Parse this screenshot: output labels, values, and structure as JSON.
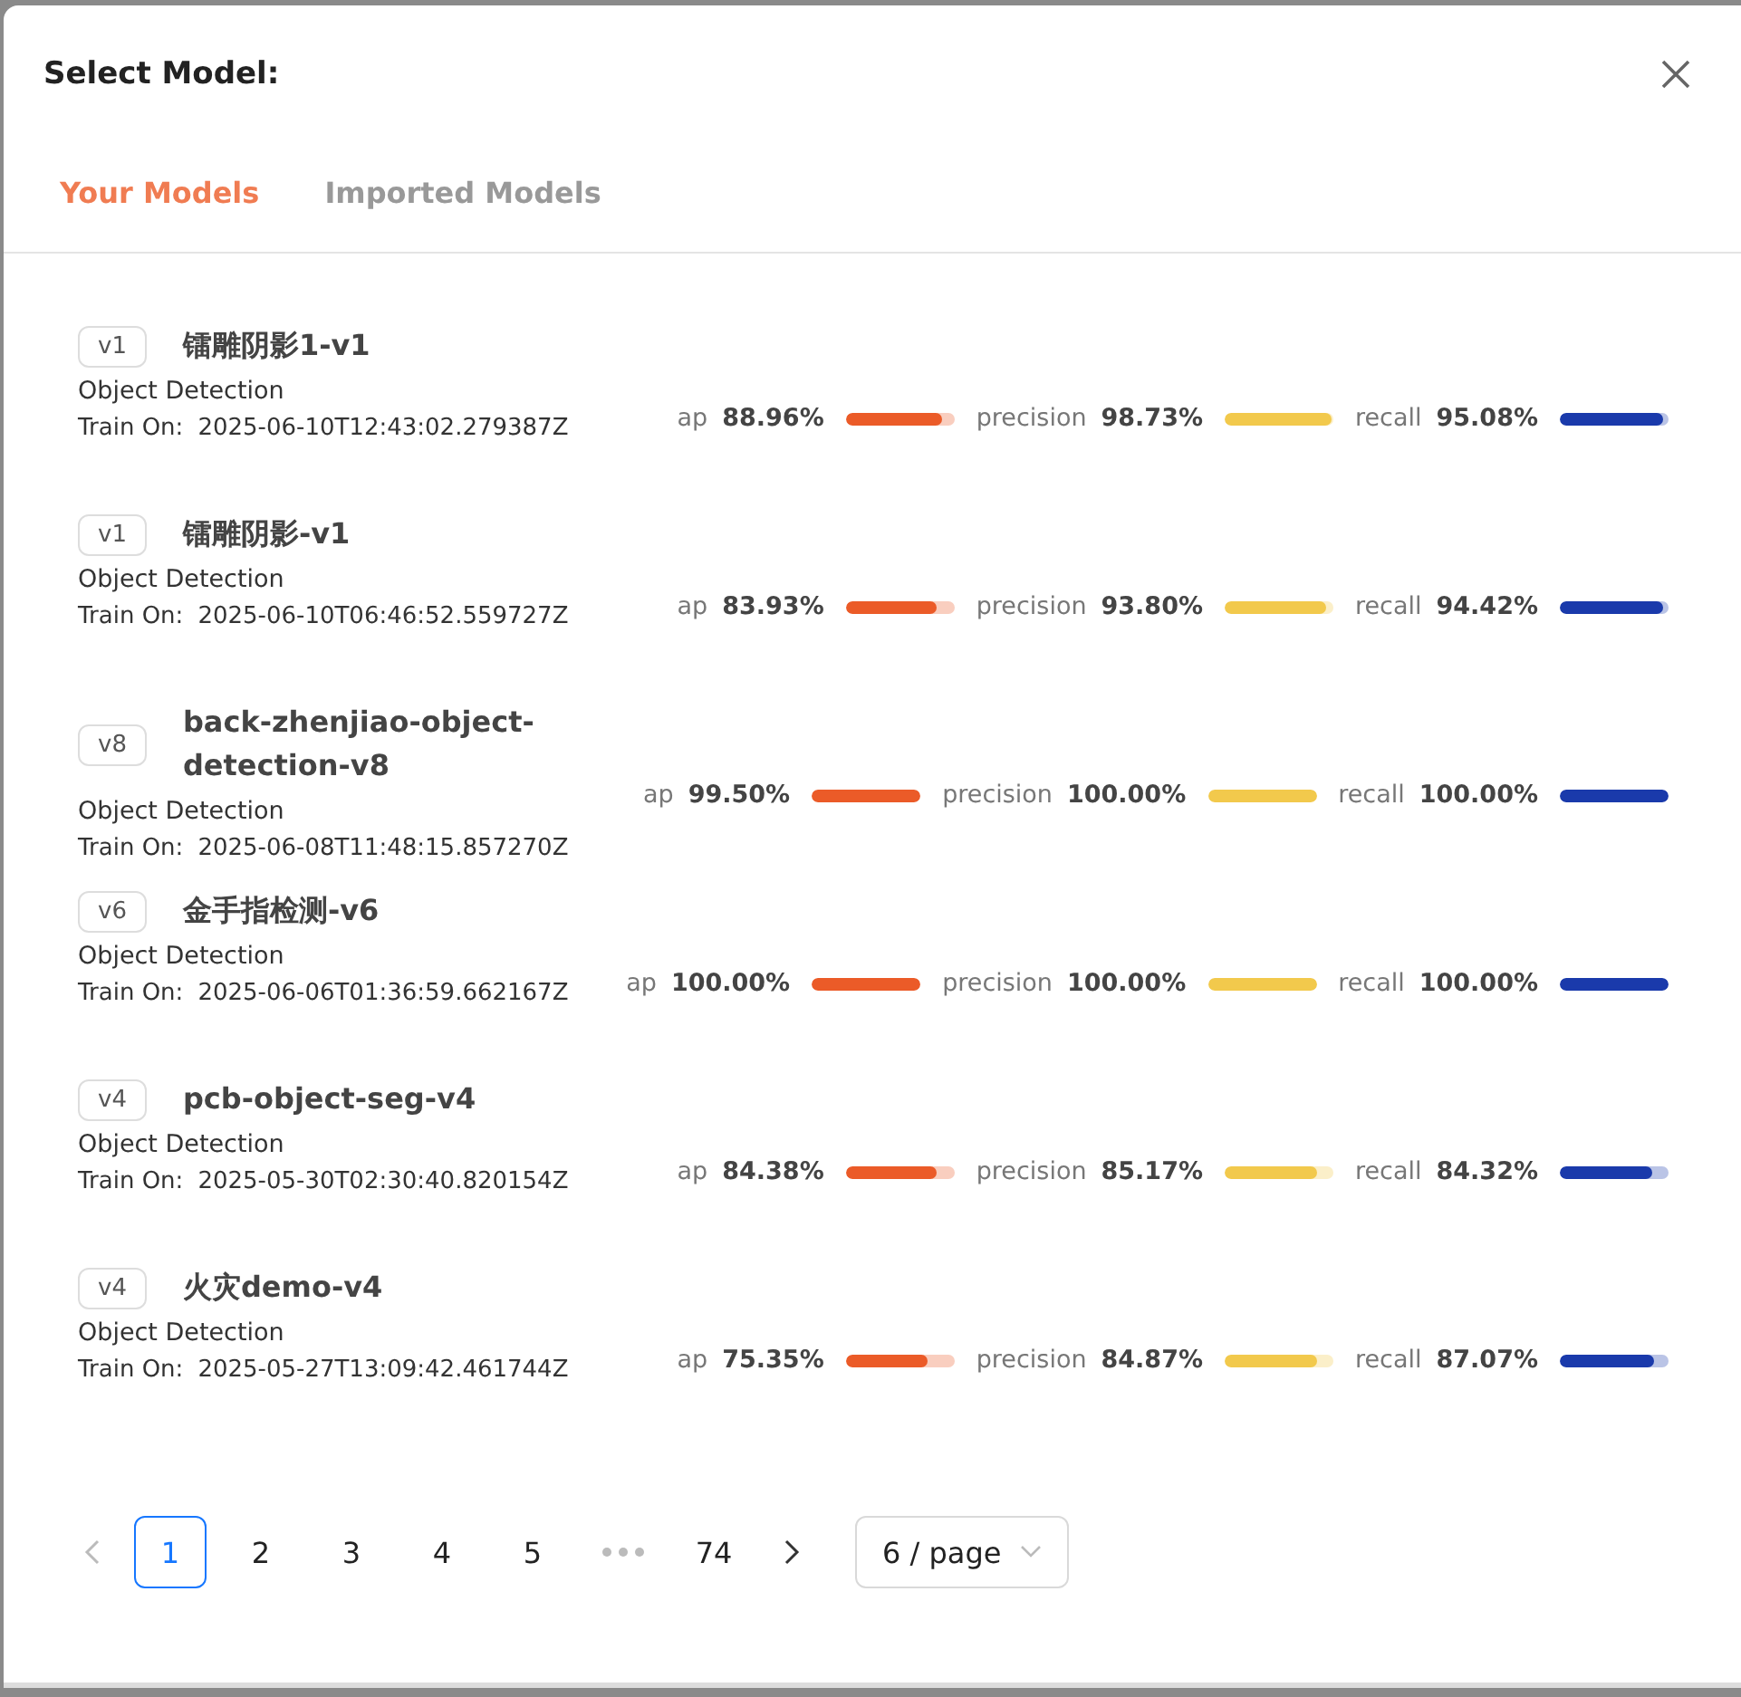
{
  "dialog": {
    "title": "Select Model:"
  },
  "tabs": [
    {
      "label": "Your Models",
      "selected": true
    },
    {
      "label": "Imported Models",
      "selected": false
    }
  ],
  "models": [
    {
      "version": "v1",
      "name": "镭雕阴影1-v1",
      "task": "Object Detection",
      "train_label": "Train On:",
      "train_on": "2025-06-10T12:43:02.279387Z",
      "metrics": [
        {
          "label": "ap",
          "value": "88.96%",
          "level": 0.8896,
          "color": "#eb5b28"
        },
        {
          "label": "precision",
          "value": "98.73%",
          "level": 0.9873,
          "color": "#f2c94c"
        },
        {
          "label": "recall",
          "value": "95.08%",
          "level": 0.9508,
          "color": "#1a3aab"
        }
      ]
    },
    {
      "version": "v1",
      "name": "镭雕阴影-v1",
      "task": "Object Detection",
      "train_label": "Train On:",
      "train_on": "2025-06-10T06:46:52.559727Z",
      "metrics": [
        {
          "label": "ap",
          "value": "83.93%",
          "level": 0.8393,
          "color": "#eb5b28"
        },
        {
          "label": "precision",
          "value": "93.80%",
          "level": 0.938,
          "color": "#f2c94c"
        },
        {
          "label": "recall",
          "value": "94.42%",
          "level": 0.9442,
          "color": "#1a3aab"
        }
      ]
    },
    {
      "version": "v8",
      "name": "back-zhenjiao-object-detection-v8",
      "task": "Object Detection",
      "train_label": "Train On:",
      "train_on": "2025-06-08T11:48:15.857270Z",
      "metrics": [
        {
          "label": "ap",
          "value": "99.50%",
          "level": 0.995,
          "color": "#eb5b28"
        },
        {
          "label": "precision",
          "value": "100.00%",
          "level": 1,
          "color": "#f2c94c"
        },
        {
          "label": "recall",
          "value": "100.00%",
          "level": 1,
          "color": "#1a3aab"
        }
      ]
    },
    {
      "version": "v6",
      "name": "金手指检测-v6",
      "task": "Object Detection",
      "train_label": "Train On:",
      "train_on": "2025-06-06T01:36:59.662167Z",
      "metrics": [
        {
          "label": "ap",
          "value": "100.00%",
          "level": 1,
          "color": "#eb5b28"
        },
        {
          "label": "precision",
          "value": "100.00%",
          "level": 1,
          "color": "#f2c94c"
        },
        {
          "label": "recall",
          "value": "100.00%",
          "level": 1,
          "color": "#1a3aab"
        }
      ]
    },
    {
      "version": "v4",
      "name": "pcb-object-seg-v4",
      "task": "Object Detection",
      "train_label": "Train On:",
      "train_on": "2025-05-30T02:30:40.820154Z",
      "metrics": [
        {
          "label": "ap",
          "value": "84.38%",
          "level": 0.8438,
          "color": "#eb5b28"
        },
        {
          "label": "precision",
          "value": "85.17%",
          "level": 0.8517,
          "color": "#f2c94c"
        },
        {
          "label": "recall",
          "value": "84.32%",
          "level": 0.8432,
          "color": "#1a3aab"
        }
      ]
    },
    {
      "version": "v4",
      "name": "火灾demo-v4",
      "task": "Object Detection",
      "train_label": "Train On:",
      "train_on": "2025-05-27T13:09:42.461744Z",
      "metrics": [
        {
          "label": "ap",
          "value": "75.35%",
          "level": 0.7535,
          "color": "#eb5b28"
        },
        {
          "label": "precision",
          "value": "84.87%",
          "level": 0.8487,
          "color": "#f2c94c"
        },
        {
          "label": "recall",
          "value": "87.07%",
          "level": 0.8707,
          "color": "#1a3aab"
        }
      ]
    }
  ],
  "pagination": {
    "prev_disabled": true,
    "next_disabled": false,
    "pages_before": [
      {
        "label": "1",
        "selected": true
      },
      {
        "label": "2",
        "selected": false
      },
      {
        "label": "3",
        "selected": false
      },
      {
        "label": "4",
        "selected": false
      },
      {
        "label": "5",
        "selected": false
      }
    ],
    "pages_after": [
      {
        "label": "74",
        "selected": false
      }
    ],
    "page_size": "6 / page"
  }
}
